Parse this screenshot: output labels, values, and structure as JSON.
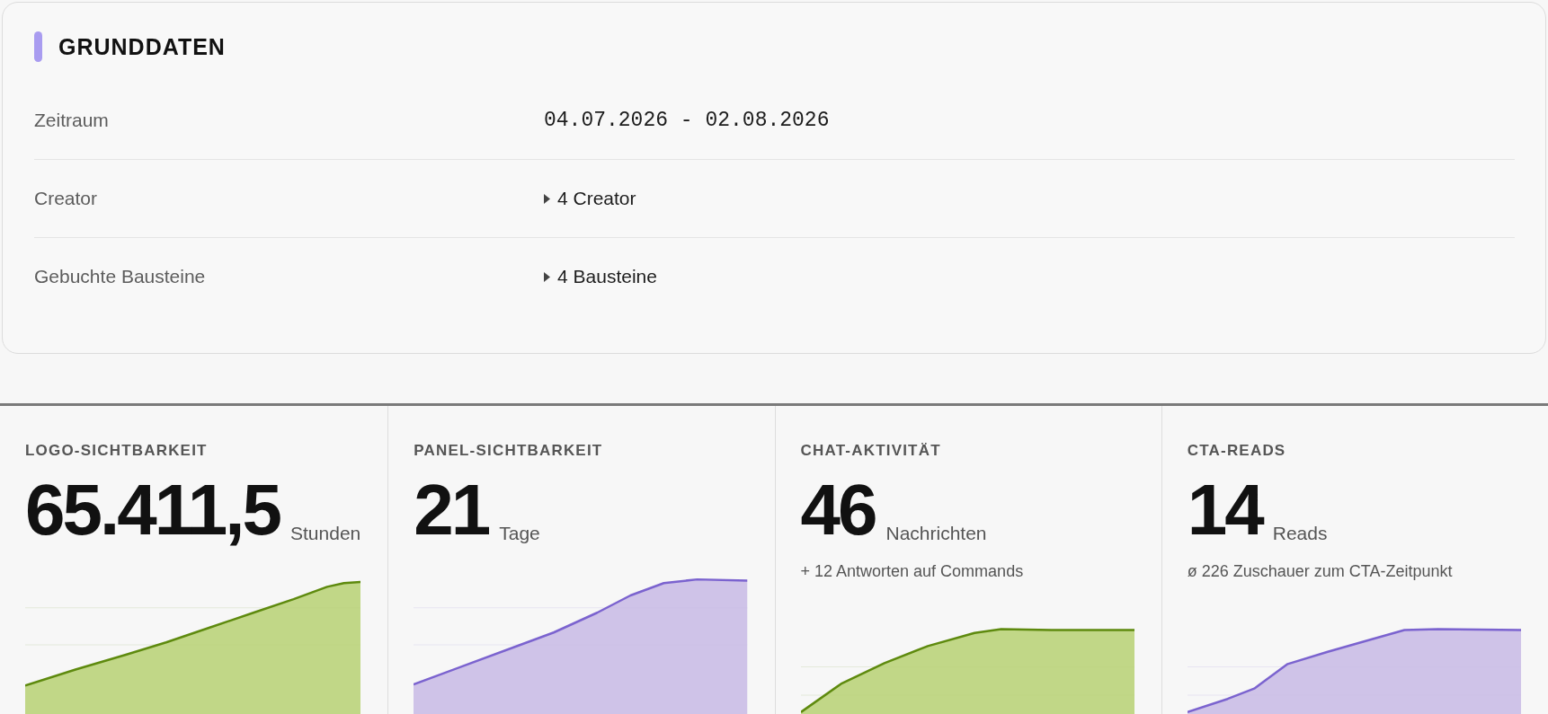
{
  "basics": {
    "title": "GRUNDDATEN",
    "rows": [
      {
        "label": "Zeitraum",
        "kind": "date",
        "value": "04.07.2026 - 02.08.2026"
      },
      {
        "label": "Creator",
        "kind": "expandable",
        "value": "4 Creator",
        "expanded": false
      },
      {
        "label": "Gebuchte Bausteine",
        "kind": "expandable",
        "value": "4 Bausteine",
        "expanded": false
      }
    ]
  },
  "stats": [
    {
      "label": "LOGO-SICHTBARKEIT",
      "value": "65.411,5",
      "unit": "Stunden",
      "color": "#5e8a0e"
    },
    {
      "label": "PANEL-SICHTBARKEIT",
      "value": "21",
      "unit": "Tage",
      "color": "#7b63cf"
    },
    {
      "label": "CHAT-AKTIVITÄT",
      "value": "46",
      "unit": "Nachrichten",
      "note": "+ 12 Antworten auf Commands",
      "color": "#5e8a0e"
    },
    {
      "label": "CTA-READS",
      "value": "14",
      "unit": "Reads",
      "note": "ø 226 Zuschauer zum CTA-Zeitpunkt",
      "color": "#7b63cf"
    }
  ]
}
